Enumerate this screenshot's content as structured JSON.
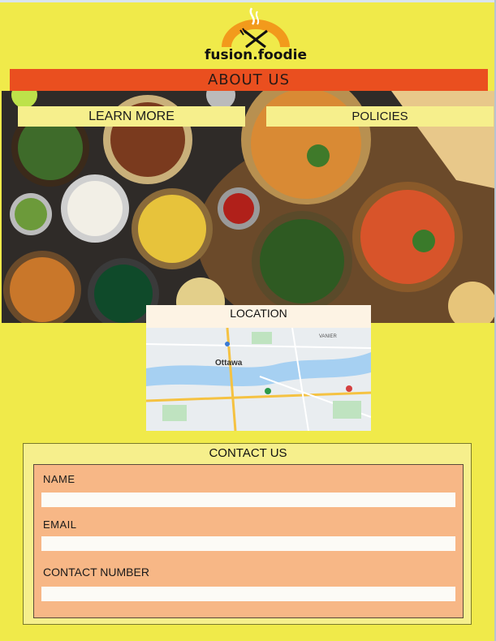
{
  "brand": {
    "name": "fusion.foodie",
    "logo_icon": "chef-fork-knife-logo"
  },
  "header": {
    "about_label": "ABOUT US"
  },
  "nav": {
    "learn_more_label": "LEARN MORE",
    "policies_label": "POLICIES"
  },
  "hero": {
    "image": "indian-food-spread-photo"
  },
  "location": {
    "title": "LOCATION",
    "map_labels": {
      "city": "Ottawa",
      "area": "VANIER"
    }
  },
  "contact": {
    "title": "CONTACT US",
    "fields": [
      {
        "label": "NAME",
        "value": ""
      },
      {
        "label": "EMAIL",
        "value": ""
      },
      {
        "label": "CONTACT NUMBER",
        "value": ""
      }
    ]
  },
  "colors": {
    "background": "#f0ea4a",
    "about_bar": "#ea4f1f",
    "tab_bg": "#f6ef8c",
    "form_bg": "#f7b786",
    "logo_arc": "#f29a1c"
  }
}
